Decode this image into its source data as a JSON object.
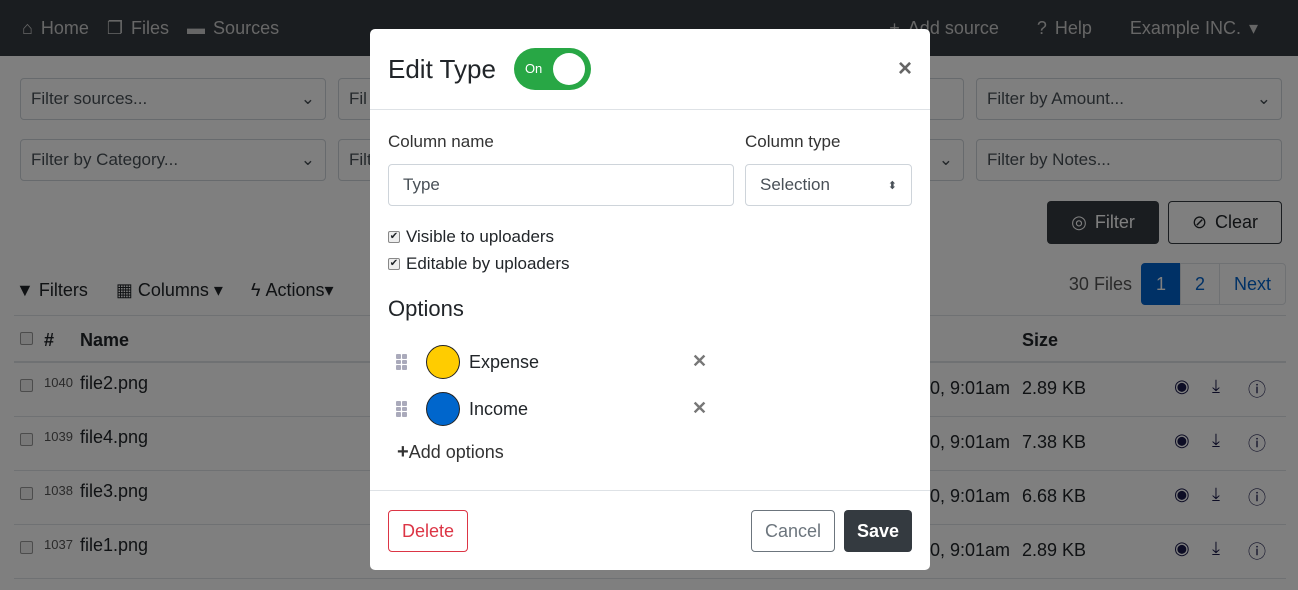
{
  "nav": {
    "items": [
      {
        "icon": "home-icon",
        "label": "Home"
      },
      {
        "icon": "files-icon",
        "label": "Files"
      },
      {
        "icon": "folder-icon",
        "label": "Sources"
      }
    ],
    "add_source": "Add source",
    "help": "Help",
    "org": "Example INC."
  },
  "filters": {
    "row1": [
      "Filter sources...",
      "Fil",
      "",
      "Filter by Amount..."
    ],
    "row2": [
      "Filter by Category...",
      "Filt",
      "",
      "Filter by Notes..."
    ],
    "filter_btn": "Filter",
    "clear_btn": "Clear"
  },
  "toolbar": {
    "filters": "Filters",
    "columns": "Columns",
    "actions": "Actions"
  },
  "pager": {
    "count": "30 Files",
    "pages": [
      "1",
      "2"
    ],
    "next": "Next",
    "active": "1"
  },
  "table": {
    "headers": {
      "num": "#",
      "name": "Name",
      "size": "Size"
    },
    "rows": [
      {
        "id": "1040",
        "name": "file2.png",
        "date": "0, 9:01am",
        "size": "2.89 KB"
      },
      {
        "id": "1039",
        "name": "file4.png",
        "date": "0, 9:01am",
        "size": "7.38 KB"
      },
      {
        "id": "1038",
        "name": "file3.png",
        "date": "0, 9:01am",
        "size": "6.68 KB"
      },
      {
        "id": "1037",
        "name": "file1.png",
        "date": "0, 9:01am",
        "size": "2.89 KB"
      }
    ]
  },
  "modal": {
    "title": "Edit Type",
    "toggle": "On",
    "toggle_on": true,
    "column_name_label": "Column name",
    "column_name_value": "Type",
    "column_type_label": "Column type",
    "column_type_value": "Selection",
    "visible": "Visible to uploaders",
    "editable": "Editable by uploaders",
    "options_title": "Options",
    "options": [
      {
        "label": "Expense",
        "color": "#ffcc00"
      },
      {
        "label": "Income",
        "color": "#0066cc"
      }
    ],
    "add_options": "Add options",
    "delete": "Delete",
    "cancel": "Cancel",
    "save": "Save"
  }
}
